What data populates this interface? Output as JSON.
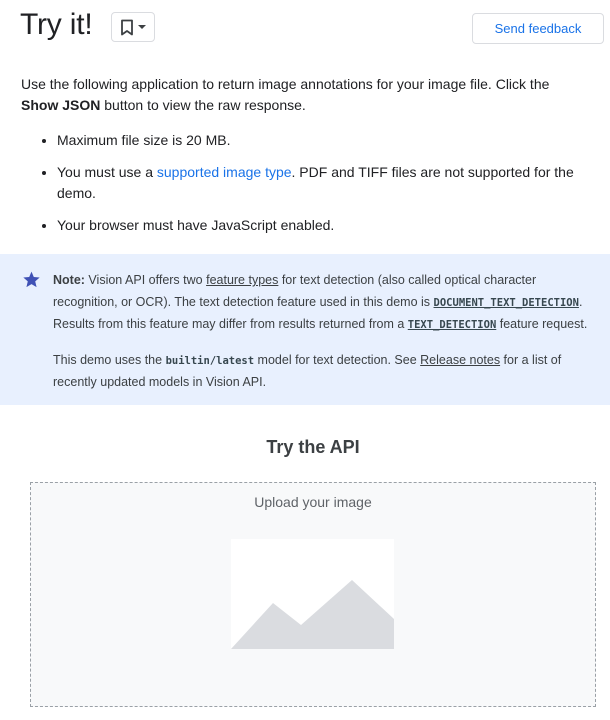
{
  "header": {
    "title": "Try it!",
    "feedback_label": "Send feedback"
  },
  "intro": {
    "text_before": "Use the following application to return image annotations for your image file. Click the",
    "bold": "Show JSON",
    "text_after": " button to view the raw response."
  },
  "requirements": {
    "item1": "Maximum file size is 20 MB.",
    "item2_before": "You must use a ",
    "item2_link": "supported image type",
    "item2_after": ". PDF and TIFF files are not supported for the demo.",
    "item3": "Your browser must have JavaScript enabled."
  },
  "note": {
    "label": "Note:",
    "p1_a": " Vision API offers two ",
    "p1_link1": "feature types",
    "p1_b": " for text detection (also called optical character recognition, or OCR). The text detection feature used in this demo is ",
    "p1_code1": "DOCUMENT_TEXT_DETECTION",
    "p1_c": ". Results from this feature may differ from results returned from a ",
    "p1_code2": "TEXT_DETECTION",
    "p1_d": " feature request.",
    "p2_a": "This demo uses the ",
    "p2_code": "builtin/latest",
    "p2_b": " model for text detection. See ",
    "p2_link": "Release notes",
    "p2_c": " for a list of recently updated models in Vision API."
  },
  "api": {
    "title": "Try the API",
    "upload_label": "Upload your image"
  },
  "icons": {
    "bookmark": "bookmark-icon",
    "dropdown": "dropdown-arrow-icon",
    "star": "star-icon",
    "image_placeholder": "image-placeholder-icon"
  },
  "colors": {
    "link": "#1a73e8",
    "note_bg": "#e8f0fe",
    "star": "#3f51b5"
  }
}
